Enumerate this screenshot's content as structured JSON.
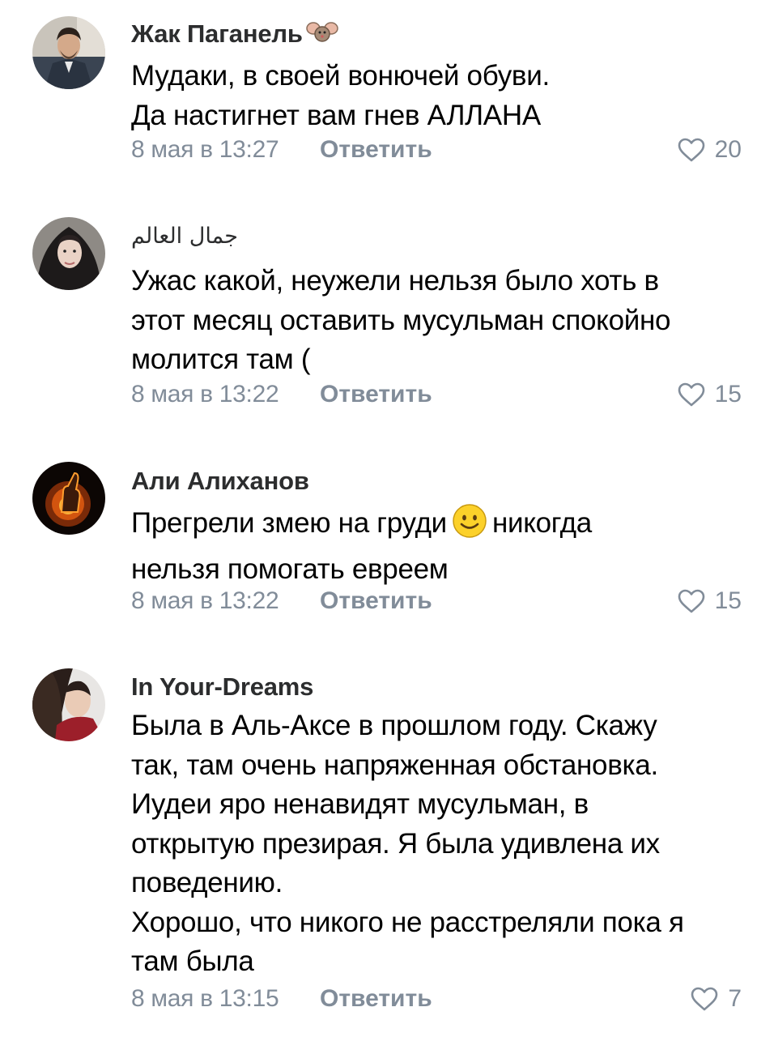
{
  "comments": [
    {
      "author": "Жак Паганель",
      "lines": [
        "Мудаки, в своей вонючей обуви.",
        "Да настигнет вам гнев АЛЛАНА"
      ],
      "date": "8 мая в 13:27",
      "reply": "Ответить",
      "likes": "20"
    },
    {
      "author": "جمال العالم",
      "lines": [
        "Ужас какой, неужели нельзя было хоть в",
        "этот месяц оставить мусульман спокойно",
        "молится там ("
      ],
      "date": "8 мая в 13:22",
      "reply": "Ответить",
      "likes": "15"
    },
    {
      "author": "Али Алиханов",
      "line1_a": "Прегрели змею на груди",
      "line1_b": "никогда",
      "line2": "нельзя помогать евреем",
      "date": "8 мая в 13:22",
      "reply": "Ответить",
      "likes": "15"
    },
    {
      "author": "In Your-Dreams",
      "lines": [
        "Была в Аль-Аксе в прошлом году. Скажу",
        "так, там очень напряженная обстановка.",
        "Иудеи яро ненавидят мусульман, в",
        "открытую презирая. Я была удивлена их",
        "поведению.",
        "Хорошо, что никого не расстреляли пока я",
        "там была"
      ],
      "date": "8 мая в 13:15",
      "reply": "Ответить",
      "likes": "7"
    }
  ],
  "colors": {
    "meta": "#818c99",
    "author": "#2c2d2e",
    "text": "#000000"
  },
  "icons": {
    "like": "heart-outline-icon",
    "badge": "mouse-badge-icon",
    "emoji": "smiley-emoji-icon"
  }
}
